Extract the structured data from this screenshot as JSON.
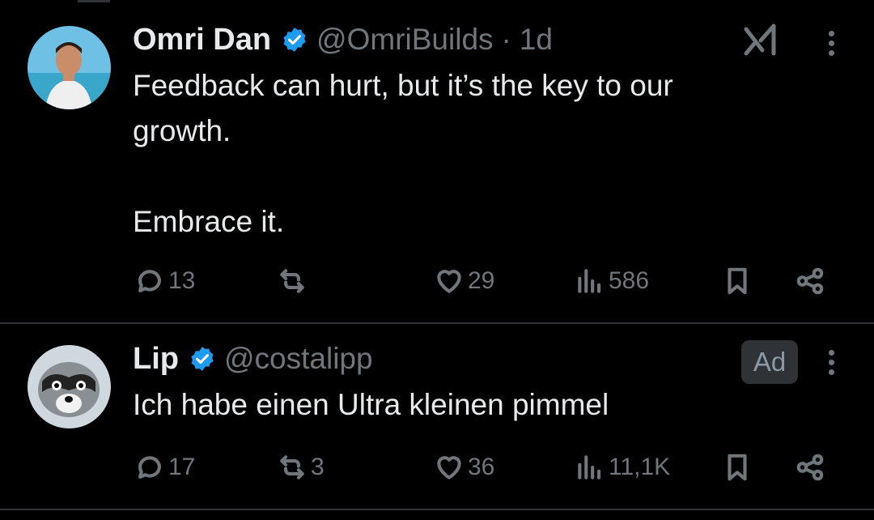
{
  "tweets": [
    {
      "author_name": "Omri Dan",
      "handle": "@OmriBuilds",
      "separator": "·",
      "time": "1d",
      "text": "Feedback can hurt, but it’s the key to our\ngrowth.\n\nEmbrace it.",
      "replies": "13",
      "reposts": "",
      "likes": "29",
      "views": "586",
      "icon": "grok-icon"
    },
    {
      "author_name": "Lip",
      "handle": "@costalipp",
      "badge": "Ad",
      "text": "Ich habe einen Ultra kleinen pimmel",
      "replies": "17",
      "reposts": "3",
      "likes": "36",
      "views": "11,1K"
    }
  ],
  "colors": {
    "background": "#000000",
    "text": "#e7e9ea",
    "muted": "#71767b",
    "verified": "#1d9bf0",
    "divider": "#2f3336"
  }
}
